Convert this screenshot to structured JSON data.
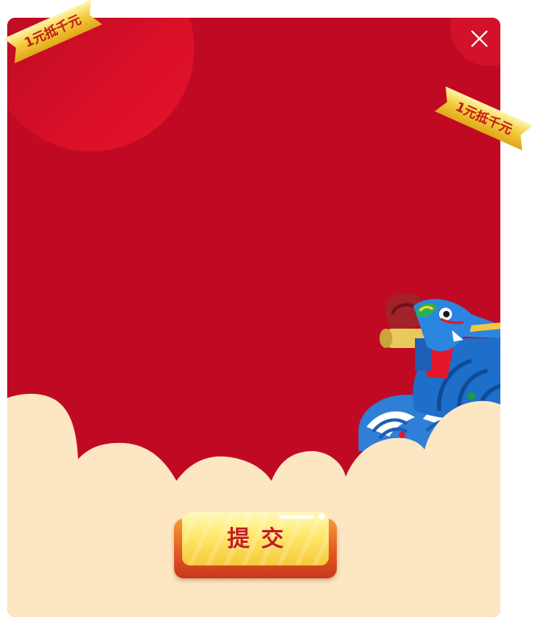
{
  "dialog": {
    "close_icon": "close-icon",
    "submit_label": "提交"
  },
  "ribbons": {
    "left_text": "1元抵千元",
    "right_text": "1元抵千元"
  },
  "decor": {
    "illustration": "dragon-boat-head",
    "background_motif": "cloud-border"
  },
  "colors": {
    "modal_red": "#c00a23",
    "cloud_cream": "#fde6c2",
    "ribbon_gold": "#f5cd3e",
    "button_yellow": "#ffe76a",
    "button_text_red": "#c31d1d"
  }
}
